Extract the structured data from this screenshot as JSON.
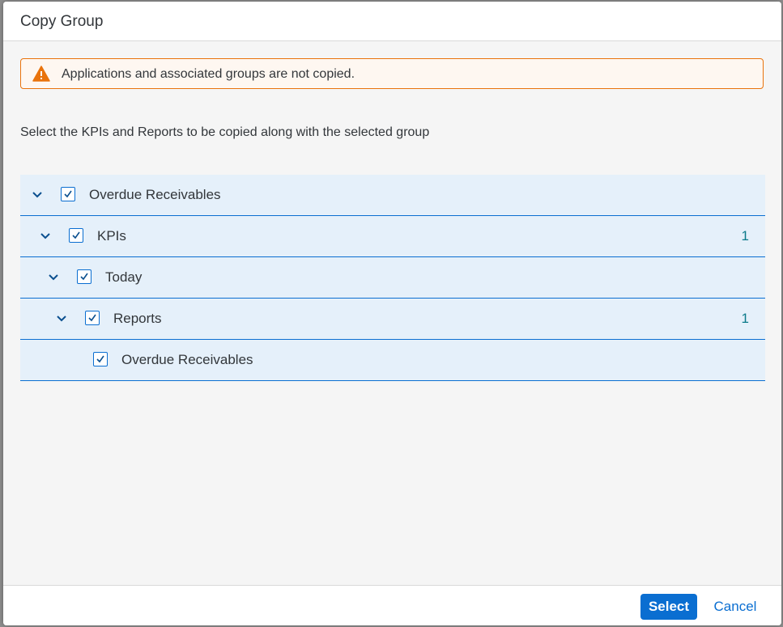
{
  "dialog": {
    "title": "Copy Group"
  },
  "warning": {
    "icon": "warning-triangle-icon",
    "color": "#e9730c",
    "text": "Applications and associated groups are not copied."
  },
  "instruction": "Select the KPIs and Reports to be copied along with the selected group",
  "tree": {
    "rows": [
      {
        "label": "Overdue Receivables",
        "level": 0,
        "expanded": true,
        "checked": true,
        "count": ""
      },
      {
        "label": "KPIs",
        "level": 1,
        "expanded": true,
        "checked": true,
        "count": "1"
      },
      {
        "label": "Today",
        "level": 2,
        "expanded": true,
        "checked": true,
        "count": ""
      },
      {
        "label": "Reports",
        "level": 3,
        "expanded": true,
        "checked": true,
        "count": "1"
      },
      {
        "label": "Overdue Receivables",
        "level": 4,
        "expanded": false,
        "checked": true,
        "count": ""
      }
    ]
  },
  "footer": {
    "select_label": "Select",
    "cancel_label": "Cancel"
  },
  "colors": {
    "accent": "#0a6ed1",
    "row_background": "#e5f0fa",
    "counter": "#0b7a8a"
  }
}
